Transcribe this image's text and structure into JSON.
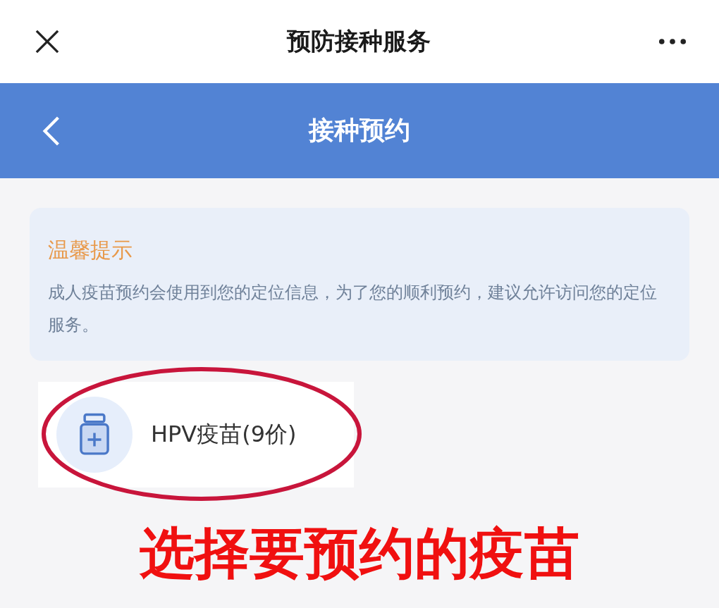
{
  "top_bar": {
    "title": "预防接种服务"
  },
  "header": {
    "title": "接种预约"
  },
  "notice": {
    "title": "温馨提示",
    "body": "成人疫苗预约会使用到您的定位信息，为了您的顺利预约，建议允许访问您的定位服务。"
  },
  "vaccines": [
    {
      "name": "HPV疫苗(9价)",
      "circled": true
    }
  ],
  "annotation": {
    "caption": "选择要预约的疫苗"
  }
}
